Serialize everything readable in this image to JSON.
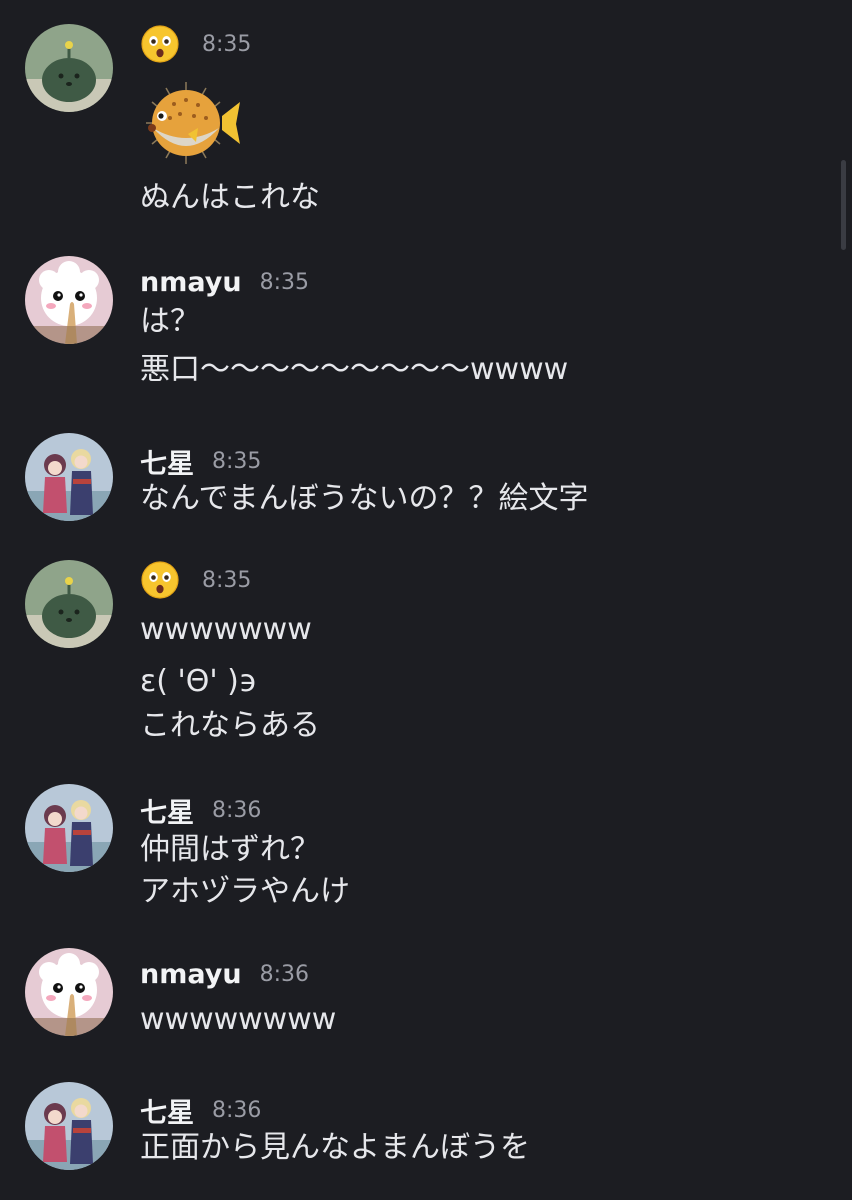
{
  "messages": [
    {
      "author_emoji": "astonished-face",
      "time": "8:35",
      "big_emoji": "blowfish",
      "lines": [
        "ぬんはこれな"
      ]
    },
    {
      "author": "nmayu",
      "time": "8:35",
      "lines": [
        "は？",
        "悪口〜〜〜〜〜〜〜〜〜wwww"
      ]
    },
    {
      "author": "七星",
      "time": "8:35",
      "lines": [
        "なんでまんぼうないの？？絵文字"
      ]
    },
    {
      "author_emoji": "astonished-face",
      "time": "8:35",
      "lines": [
        "wwwwwww",
        "ε( 'Θ' )϶",
        "これならある"
      ]
    },
    {
      "author": "七星",
      "time": "8:36",
      "lines": [
        "仲間はずれ？",
        "アホヅラやんけ"
      ]
    },
    {
      "author": "nmayu",
      "time": "8:36",
      "lines": [
        "wwwwwwww"
      ]
    },
    {
      "author": "七星",
      "time": "8:36",
      "lines": [
        "正面から見んなよまんぼうを"
      ]
    }
  ],
  "colors": {
    "background": "#1c1d22",
    "text": "#e6e7eb",
    "username": "#f2f3f5",
    "timestamp": "#9a9ca5"
  }
}
